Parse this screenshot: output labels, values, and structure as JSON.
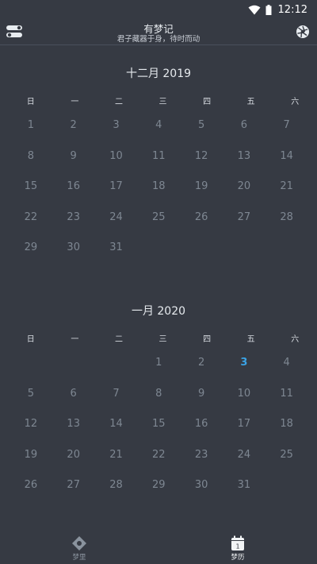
{
  "status": {
    "time": "12:12"
  },
  "header": {
    "title": "有梦记",
    "subtitle": "君子藏器于身，待时而动"
  },
  "weekdays": [
    "日",
    "一",
    "二",
    "三",
    "四",
    "五",
    "六"
  ],
  "months": [
    {
      "title": "十二月 2019",
      "days": [
        "1",
        "2",
        "3",
        "4",
        "5",
        "6",
        "7",
        "8",
        "9",
        "10",
        "11",
        "12",
        "13",
        "14",
        "15",
        "16",
        "17",
        "18",
        "19",
        "20",
        "21",
        "22",
        "23",
        "24",
        "25",
        "26",
        "27",
        "28",
        "29",
        "30",
        "31"
      ]
    },
    {
      "title": "一月 2020",
      "days": [
        "1",
        "2",
        "3",
        "4",
        "5",
        "6",
        "7",
        "8",
        "9",
        "10",
        "11",
        "12",
        "13",
        "14",
        "15",
        "16",
        "17",
        "18",
        "19",
        "20",
        "21",
        "22",
        "23",
        "24",
        "25",
        "26",
        "27",
        "28",
        "29",
        "30",
        "31"
      ]
    }
  ],
  "nav": {
    "dream_label": "梦里",
    "calendar_label": "梦历",
    "calendar_icon_num": "1"
  },
  "colors": {
    "background": "#363a43",
    "today": "#3aa3e6"
  }
}
